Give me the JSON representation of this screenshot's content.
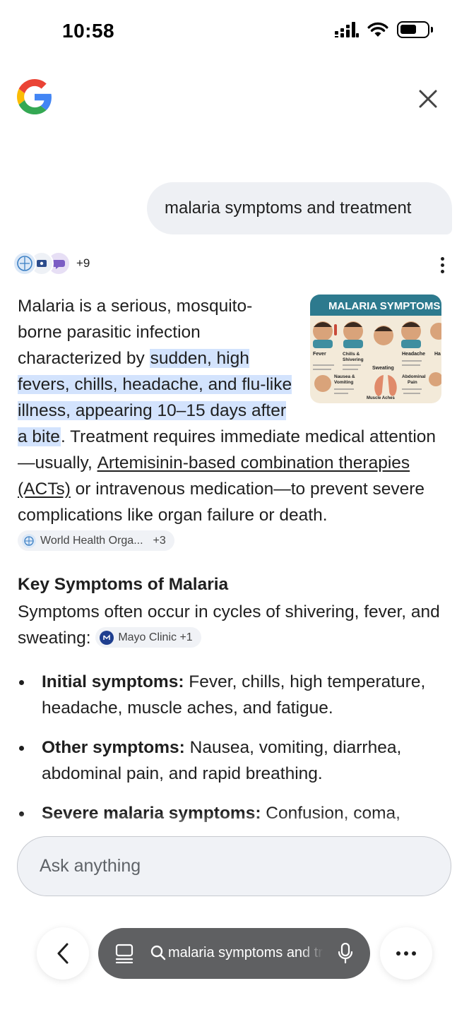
{
  "status_bar": {
    "time": "10:58",
    "icons": [
      "signal-icon",
      "wifi-icon",
      "battery-icon"
    ]
  },
  "header": {
    "logo": "google-logo",
    "close": "close-icon"
  },
  "query": {
    "text": "malaria symptoms and treatment"
  },
  "sources": {
    "more": "+9",
    "icons": [
      "who-icon",
      "source-icon",
      "source-icon"
    ]
  },
  "answer": {
    "intro": "Malaria is a serious, mosquito-borne parasitic infection characterized by ",
    "highlight": "sudden, high fevers, chills, headache, and flu-like illness, appearing 10–15 days after a bite",
    "mid": ". Treatment requires immediate medical attention—usually, ",
    "link": "Artemisinin-based combination therapies (ACTs)",
    "end": " or intravenous medication—to prevent severe complications like organ failure or death. ",
    "chip": {
      "label": "World Health Orga...",
      "more": "+3"
    },
    "image_title": "MALARIA SYMPTOMS",
    "image_labels": [
      "Fever",
      "Chills & Shivering",
      "Headache",
      "Ha",
      "Sweating",
      "Nausea & Vomiting",
      "Abdominal Pain",
      "Muscle Aches & Fatigue"
    ]
  },
  "key_symptoms": {
    "title": "Key Symptoms of Malaria",
    "text": "Symptoms often occur in cycles of shivering, fever, and sweating: ",
    "chip": {
      "label": "Mayo Clinic +1"
    },
    "bullets": [
      {
        "label": "Initial symptoms:",
        "text": " Fever, chills, high temperature, headache, muscle aches, and fatigue."
      },
      {
        "label": "Other symptoms:",
        "text": " Nausea, vomiting, diarrhea, abdominal pain, and rapid breathing."
      },
      {
        "label": "Severe malaria symptoms:",
        "text": " Confusion, coma,"
      }
    ]
  },
  "ask": {
    "placeholder": "Ask anything"
  },
  "bottom_bar": {
    "search_text": "malaria symptoms and treatment"
  },
  "colors": {
    "highlight": "#d3e3fd",
    "pill": "#5f6062",
    "bubble": "#eef0f4"
  }
}
